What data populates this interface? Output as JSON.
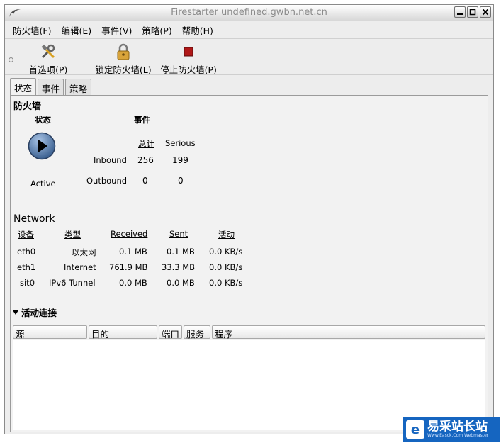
{
  "window": {
    "title": "Firestarter undefined.gwbn.net.cn"
  },
  "menu": [
    "防火墙(F)",
    "编辑(E)",
    "事件(V)",
    "策略(P)",
    "帮助(H)"
  ],
  "toolbar": {
    "prefs": "首选项(P)",
    "lock": "锁定防火墙(L)",
    "stop": "停止防火墙(P)"
  },
  "tabs": [
    "状态",
    "事件",
    "策略"
  ],
  "firewall": {
    "heading": "防火墙",
    "status_label": "状态",
    "events_label": "事件",
    "status_value": "Active",
    "col_total": "总计",
    "col_serious": "Serious",
    "inbound_label": "Inbound",
    "outbound_label": "Outbound",
    "inbound_total": "256",
    "inbound_serious": "199",
    "outbound_total": "0",
    "outbound_serious": "0"
  },
  "network": {
    "heading": "Network",
    "headers": [
      "设备",
      "类型",
      "Received",
      "Sent",
      "活动"
    ],
    "rows": [
      [
        "eth0",
        "以太网",
        "0.1 MB",
        "0.1 MB",
        "0.0 KB/s"
      ],
      [
        "eth1",
        "Internet",
        "761.9 MB",
        "33.3 MB",
        "0.0 KB/s"
      ],
      [
        "sit0",
        "IPv6 Tunnel",
        "0.0 MB",
        "0.0 MB",
        "0.0 KB/s"
      ]
    ]
  },
  "connections": {
    "heading": "活动连接",
    "columns": [
      "源",
      "目的",
      "端口",
      "服务",
      "程序"
    ]
  },
  "watermark": {
    "text": "易采站长站",
    "sub": "Www.Easck.Com  Webmaster"
  },
  "colors": {
    "accent": "#1565c0",
    "play_button": "#3a5f8f"
  }
}
